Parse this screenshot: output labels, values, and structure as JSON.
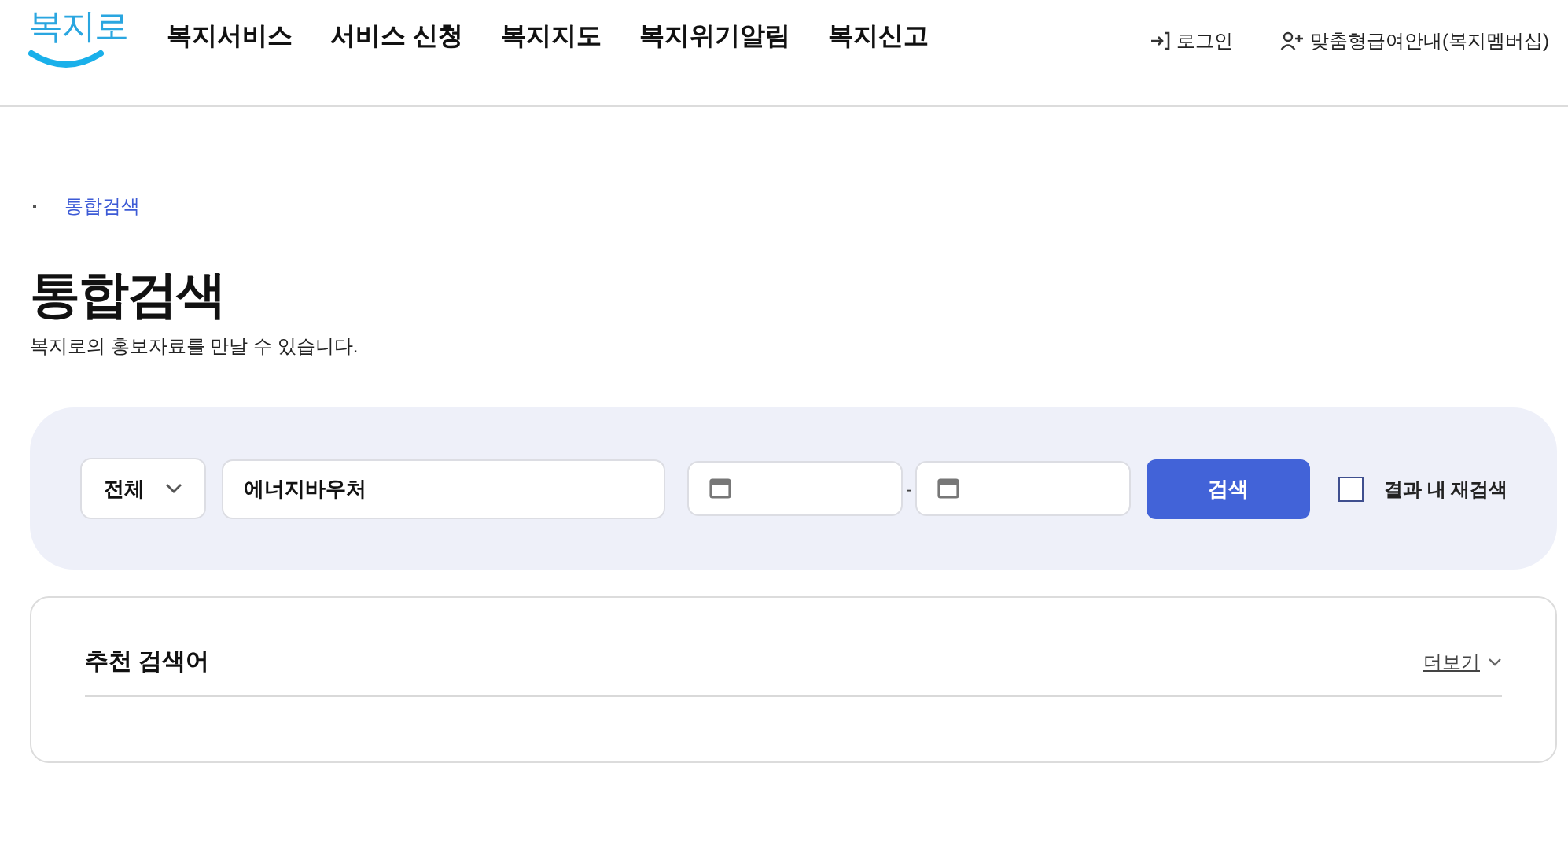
{
  "header": {
    "logo": "복지로",
    "nav": [
      "복지서비스",
      "서비스 신청",
      "복지지도",
      "복지위기알림",
      "복지신고"
    ],
    "utility_links": [
      {
        "kind": "login",
        "label": "로그인"
      },
      {
        "kind": "member",
        "label": "맞춤형급여안내(복지멤버십)"
      }
    ]
  },
  "breadcrumb": [
    "통합검색"
  ],
  "title": "통합검색",
  "subtitle": "복지로의 홍보자료를 만날 수 있습니다.",
  "search": {
    "category": "전체",
    "query": "에너지바우처",
    "date_separator": "-",
    "button": "검색",
    "refine": {
      "label": "결과 내 재검색",
      "checked": false
    }
  },
  "recommended": {
    "title": "추천 검색어",
    "more_link": "더보기"
  }
}
